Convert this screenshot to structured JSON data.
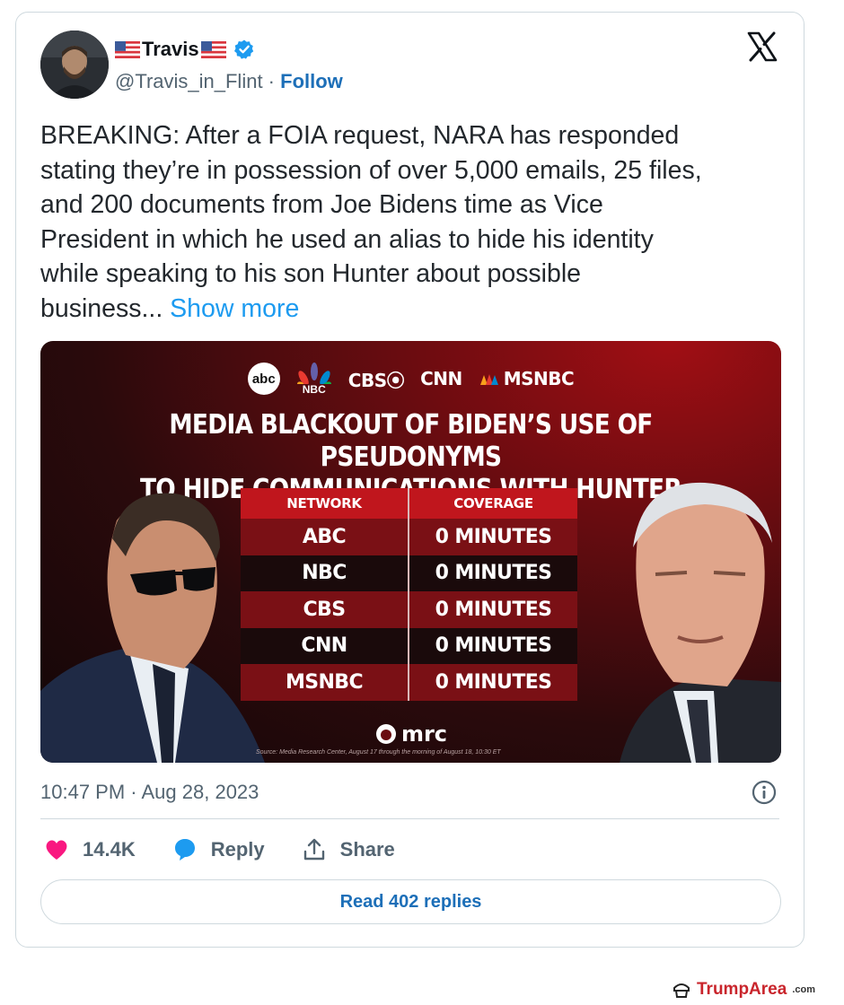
{
  "tweet": {
    "display_name": "Travis",
    "handle": "@Travis_in_Flint",
    "separator": " · ",
    "follow_label": "Follow",
    "text": "BREAKING:  After a FOIA request, NARA has responded\nstating they’re in possession of over 5,000 emails, 25 files,\nand 200 documents from Joe Bidens time as Vice\nPresident in which he used an alias to hide his identity\nwhile speaking to his son Hunter about possible\nbusiness... ",
    "show_more_label": "Show more",
    "timestamp": "10:47 PM · Aug 28, 2023",
    "likes": "14.4K",
    "reply_label": "Reply",
    "share_label": "Share",
    "read_replies_label": "Read 402 replies"
  },
  "media": {
    "logos": {
      "abc": "abc",
      "nbc": "NBC",
      "cbs": "CBS⦿",
      "cnn": "CNN",
      "msnbc": "MSNBC"
    },
    "headline_line1": "MEDIA BLACKOUT OF BIDEN’S USE OF PSEUDONYMS",
    "headline_line2": "TO HIDE COMMUNICATIONS WITH HUNTER",
    "table": {
      "headers": [
        "NETWORK",
        "COVERAGE"
      ],
      "rows": [
        [
          "ABC",
          "0 MINUTES"
        ],
        [
          "NBC",
          "0 MINUTES"
        ],
        [
          "CBS",
          "0 MINUTES"
        ],
        [
          "CNN",
          "0 MINUTES"
        ],
        [
          "MSNBC",
          "0 MINUTES"
        ]
      ]
    },
    "footer_brand": "mrc",
    "source": "Source: Media Research Center, August 17 through the morning of August 18, 10:30 ET"
  },
  "watermark": {
    "brand": "TrumpArea",
    "suffix": ".com"
  },
  "colors": {
    "link_blue": "#1d9bf0",
    "follow_blue": "#1d6fb8",
    "like_pink": "#f91880",
    "reply_blue": "#1d9bf0",
    "table_red": "#c0161d"
  },
  "icons": [
    "avatar",
    "us-flag-icon",
    "verified-badge-icon",
    "x-logo-icon",
    "info-icon",
    "heart-icon",
    "reply-bubble-icon",
    "share-icon"
  ]
}
